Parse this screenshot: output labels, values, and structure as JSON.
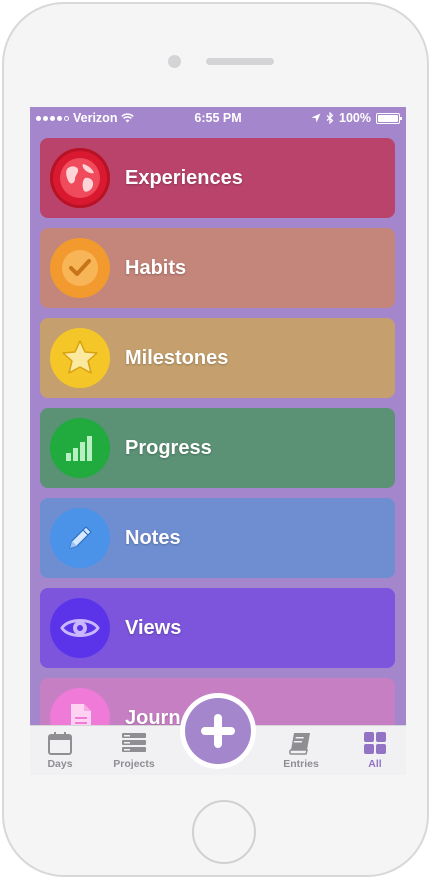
{
  "status_bar": {
    "carrier": "Verizon",
    "time": "6:55 PM",
    "battery": "100%"
  },
  "categories": [
    {
      "label": "Experiences",
      "icon": "globe-icon",
      "color": "#b9436b"
    },
    {
      "label": "Habits",
      "icon": "checkmark-icon",
      "color": "#c4857b"
    },
    {
      "label": "Milestones",
      "icon": "star-icon",
      "color": "#c5a06e"
    },
    {
      "label": "Progress",
      "icon": "bar-chart-icon",
      "color": "#5b9275"
    },
    {
      "label": "Notes",
      "icon": "pencil-icon",
      "color": "#6f8ed2"
    },
    {
      "label": "Views",
      "icon": "eye-icon",
      "color": "#7d55dc"
    },
    {
      "label": "Journ",
      "icon": "document-icon",
      "color": "#c77fc4"
    }
  ],
  "tabs": [
    {
      "label": "Days",
      "icon": "calendar-icon"
    },
    {
      "label": "Projects",
      "icon": "stack-icon"
    },
    {
      "label": "Entries",
      "icon": "book-icon"
    },
    {
      "label": "All",
      "icon": "grid-icon",
      "active": true
    }
  ],
  "colors": {
    "screen_background": "#a386cc",
    "active_tab": "#9273c4",
    "inactive_tab": "#8e8e93"
  }
}
